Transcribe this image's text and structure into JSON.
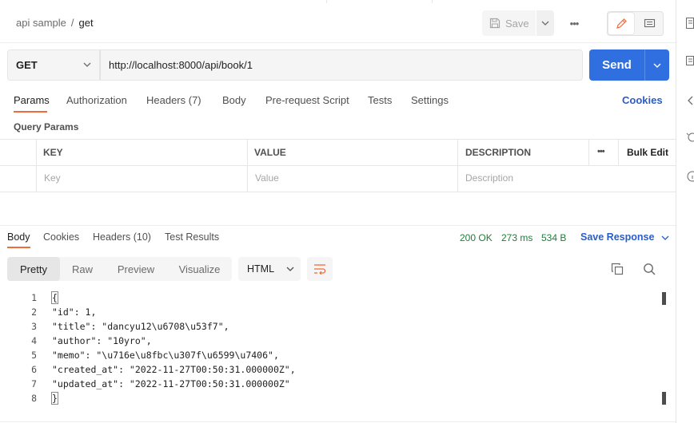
{
  "breadcrumb": {
    "collection": "api sample",
    "separator": "/",
    "request": "get"
  },
  "toolbar": {
    "save_label": "Save",
    "more_label": "•••"
  },
  "request": {
    "method": "GET",
    "url": "http://localhost:8000/api/book/1",
    "send_label": "Send"
  },
  "request_tabs": {
    "params": "Params",
    "authorization": "Authorization",
    "headers": "Headers (7)",
    "body": "Body",
    "prerequest": "Pre-request Script",
    "tests": "Tests",
    "settings": "Settings",
    "cookies": "Cookies"
  },
  "query_params": {
    "title": "Query Params",
    "columns": {
      "key": "KEY",
      "value": "VALUE",
      "description": "DESCRIPTION",
      "more": "•••",
      "bulk_edit": "Bulk Edit"
    },
    "placeholders": {
      "key": "Key",
      "value": "Value",
      "description": "Description"
    }
  },
  "response": {
    "tabs": {
      "body": "Body",
      "cookies": "Cookies",
      "headers": "Headers (10)",
      "test_results": "Test Results"
    },
    "status": "200 OK",
    "time": "273 ms",
    "size": "534 B",
    "save_response": "Save Response",
    "views": {
      "pretty": "Pretty",
      "raw": "Raw",
      "preview": "Preview",
      "visualize": "Visualize"
    },
    "format": "HTML",
    "lines": [
      {
        "n": "1",
        "text": "{"
      },
      {
        "n": "2",
        "text": "\"id\": 1,"
      },
      {
        "n": "3",
        "text": "\"title\": \"dancyu12\\u6708\\u53f7\","
      },
      {
        "n": "4",
        "text": "\"author\": \"10yro\","
      },
      {
        "n": "5",
        "text": "\"memo\": \"\\u716e\\u8fbc\\u307f\\u6599\\u7406\","
      },
      {
        "n": "6",
        "text": "\"created_at\": \"2022-11-27T00:50:31.000000Z\","
      },
      {
        "n": "7",
        "text": "\"updated_at\": \"2022-11-27T00:50:31.000000Z\""
      },
      {
        "n": "8",
        "text": "}"
      }
    ]
  },
  "colors": {
    "accent": "#f26b3a",
    "primary": "#2f6fe0",
    "link": "#2a5cc9",
    "success": "#1e7d38"
  }
}
